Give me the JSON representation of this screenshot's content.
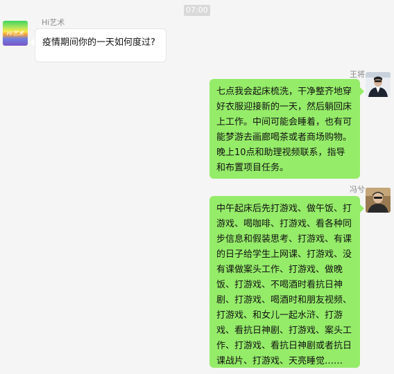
{
  "timestamp": "07:00",
  "messages": [
    {
      "sender": "Hi艺术",
      "avatar_text": "Hi艺术",
      "text": "疫情期间你的一天如何度过?"
    },
    {
      "sender": "王将",
      "text": "七点我会起床梳洗，干净整齐地穿\n好衣服迎接新的一天，然后躺回床\n上工作。中间可能会睡着，也有可\n能梦游去画廊喝茶或者商场购物。\n晚上10点和助理视频联系，指导\n和布置项目任务。"
    },
    {
      "sender": "冯兮",
      "text": "中午起床后先打游戏、做午饭、打\n游戏、喝咖啡、打游戏、看各种同\n步信息和假装思考、打游戏、有课\n的日子给学生上网课、打游戏、没\n有课做案头工作、打游戏、做晚\n饭、打游戏、不喝酒时看抗日神\n剧、打游戏、喝酒时和朋友视频、\n打游戏、和女儿一起水浒、打游\n戏、看抗日神剧、打游戏、案头工\n作、打游戏、看抗日神剧或者抗日\n课战片、打游戏、天亮睡觉……"
    }
  ],
  "colors": {
    "background": "#f5f5f5",
    "sent_bubble": "#95ec69",
    "received_bubble": "#ffffff"
  }
}
